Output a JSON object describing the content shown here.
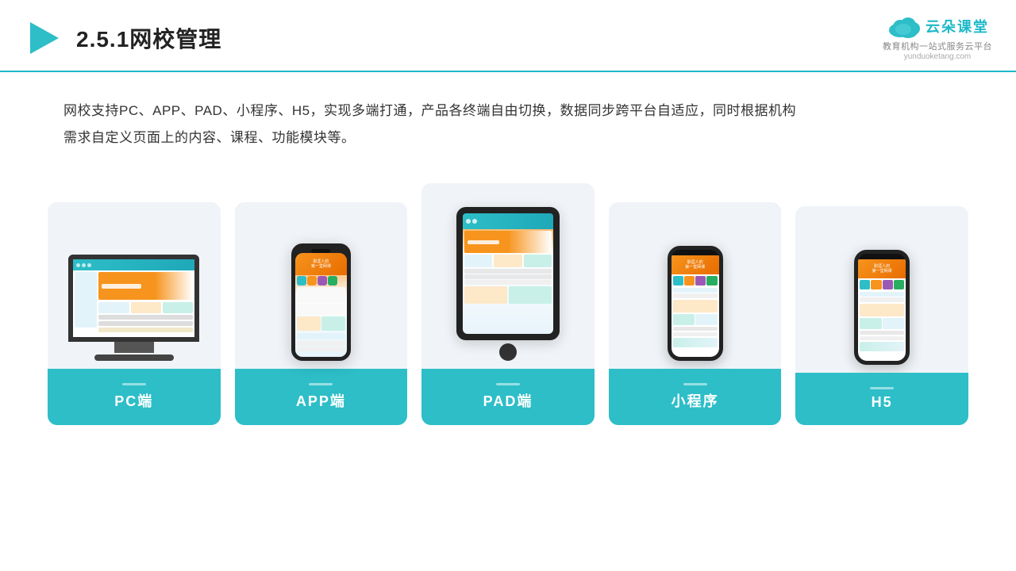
{
  "header": {
    "title": "2.5.1网校管理",
    "logo_name": "云朵课堂",
    "logo_url": "yunduoketang.com",
    "logo_tagline": "教育机构一站式服务云平台"
  },
  "description": {
    "text": "网校支持PC、APP、PAD、小程序、H5，实现多端打通，产品各终端自由切换，数据同步跨平台自适应，同时根据机构需求自定义页面上的内容、课程、功能模块等。"
  },
  "cards": [
    {
      "id": "pc",
      "label": "PC端"
    },
    {
      "id": "app",
      "label": "APP端"
    },
    {
      "id": "pad",
      "label": "PAD端"
    },
    {
      "id": "miniprogram",
      "label": "小程序"
    },
    {
      "id": "h5",
      "label": "H5"
    }
  ],
  "colors": {
    "accent": "#2dbec8",
    "title_border": "#1db8c8",
    "card_bg": "#f0f4f8",
    "label_bg": "#2dbec8",
    "label_text": "#ffffff",
    "orange": "#f7941d"
  }
}
